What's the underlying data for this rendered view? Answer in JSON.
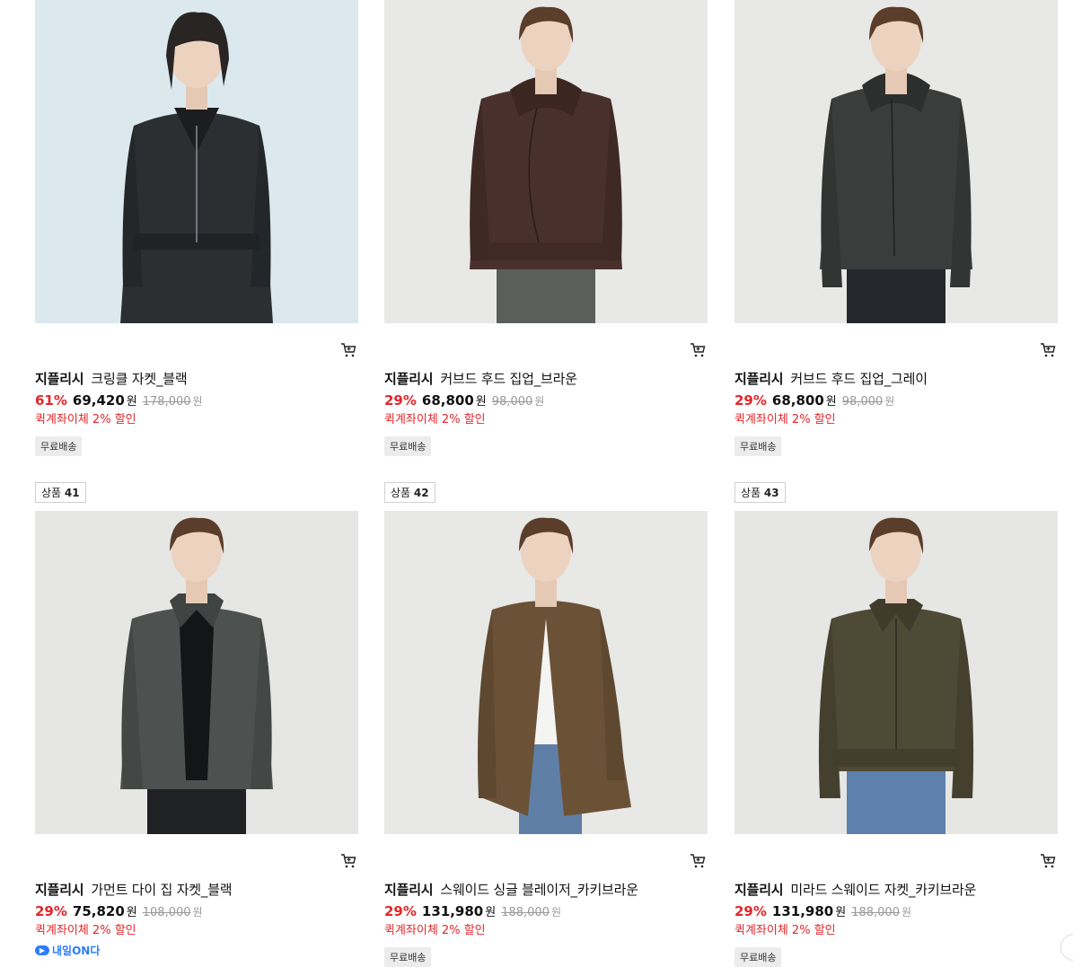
{
  "products": [
    {
      "brand": "지플리시",
      "name": "크링클 자켓_블랙",
      "discount": "61%",
      "price": "69,420",
      "currency": "원",
      "original_price": "178,000",
      "original_currency": "원",
      "promo": "퀵계좌이체 2% 할인",
      "badge": "무료배송",
      "bg": "#dbe9ef",
      "garment": "#2b2f32",
      "pants": "#3a4152"
    },
    {
      "brand": "지플리시",
      "name": "커브드 후드 집업_브라운",
      "discount": "29%",
      "price": "68,800",
      "currency": "원",
      "original_price": "98,000",
      "original_currency": "원",
      "promo": "퀵계좌이체 2% 할인",
      "badge": "무료배송",
      "bg": "#e8e8e6",
      "garment": "#4a302c",
      "pants": "#5b5f5c"
    },
    {
      "brand": "지플리시",
      "name": "커브드 후드 집업_그레이",
      "discount": "29%",
      "price": "68,800",
      "currency": "원",
      "original_price": "98,000",
      "original_currency": "원",
      "promo": "퀵계좌이체 2% 할인",
      "badge": "무료배송",
      "bg": "#e8e8e6",
      "garment": "#3a3d3b",
      "pants": "#24272b"
    },
    {
      "rank_label": "상품",
      "rank_num": "41",
      "brand": "지플리시",
      "name": "가먼트 다이 집 자켓_블랙",
      "discount": "29%",
      "price": "75,820",
      "currency": "원",
      "original_price": "108,000",
      "original_currency": "원",
      "promo": "퀵계좌이체 2% 할인",
      "delivery": "내일ON다",
      "bg": "#e6e6e4",
      "garment": "#4d514f",
      "pants": "#1f2124"
    },
    {
      "rank_label": "상품",
      "rank_num": "42",
      "brand": "지플리시",
      "name": "스웨이드 싱글 블레이저_카키브라운",
      "discount": "29%",
      "price": "131,980",
      "currency": "원",
      "original_price": "188,000",
      "original_currency": "원",
      "promo": "퀵계좌이체 2% 할인",
      "badge": "무료배송",
      "bg": "#e8e8e6",
      "garment": "#6b5237",
      "pants": "#5f7fa6"
    },
    {
      "rank_label": "상품",
      "rank_num": "43",
      "brand": "지플리시",
      "name": "미라드 스웨이드 자켓_카키브라운",
      "discount": "29%",
      "price": "131,980",
      "currency": "원",
      "original_price": "188,000",
      "original_currency": "원",
      "promo": "퀵계좌이체 2% 할인",
      "badge": "무료배송",
      "bg": "#e6e6e4",
      "garment": "#4f4a36",
      "pants": "#5d80ad"
    }
  ],
  "icons": {
    "cart": "cart-icon",
    "delivery": "nextday-icon"
  }
}
